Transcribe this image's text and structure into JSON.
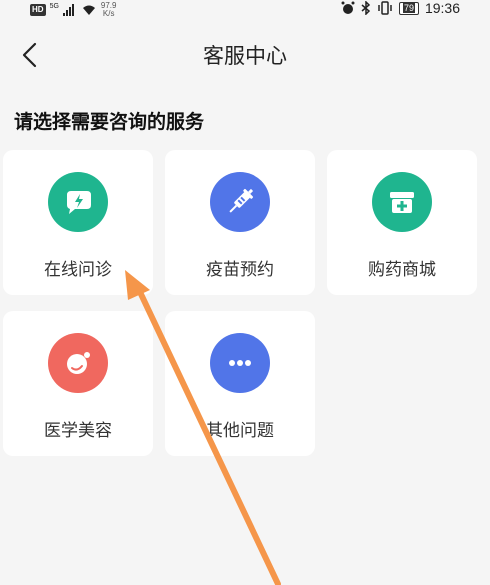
{
  "status_bar": {
    "hd": "HD",
    "signal": "5G",
    "net_speed": "97.9",
    "net_unit": "K/s",
    "battery": "79",
    "time": "19:36"
  },
  "header": {
    "title": "客服中心"
  },
  "section": {
    "title": "请选择需要咨询的服务"
  },
  "services": [
    {
      "label": "在线问诊",
      "icon": "chat-lightning-icon",
      "color": "#1fb58f"
    },
    {
      "label": "疫苗预约",
      "icon": "syringe-icon",
      "color": "#5175e8"
    },
    {
      "label": "购药商城",
      "icon": "medicine-box-icon",
      "color": "#1fb58f"
    },
    {
      "label": "医学美容",
      "icon": "beauty-icon",
      "color": "#f0685f"
    },
    {
      "label": "其他问题",
      "icon": "more-icon",
      "color": "#5175e8"
    }
  ]
}
